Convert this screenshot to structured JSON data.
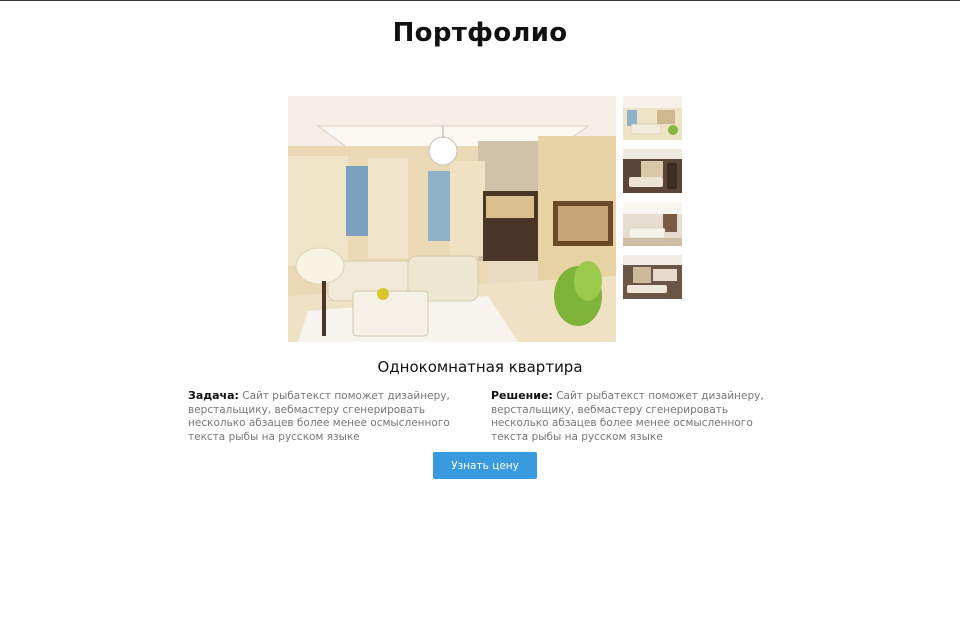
{
  "page": {
    "title": "Портфолио"
  },
  "gallery": {
    "main_alt": "living-room-photo",
    "thumbnails": [
      {
        "name": "thumb-living-room-1"
      },
      {
        "name": "thumb-dark-room"
      },
      {
        "name": "thumb-living-room-2"
      },
      {
        "name": "thumb-dark-room-2"
      }
    ]
  },
  "project": {
    "title": "Однокомнатная квартира",
    "task_label": "Задача:",
    "task_text": "Сайт рыбатекст поможет дизайнеру, верстальщику, вебмастеру сгенерировать несколько абзацев более менее осмысленного текста рыбы на русском языке",
    "solution_label": "Решение:",
    "solution_text": "Сайт рыбатекст поможет дизайнеру, верстальщику, вебмастеру сгенерировать несколько абзацев более менее осмысленного текста рыбы на русском языке"
  },
  "cta": {
    "label": "Узнать цену",
    "color": "#3a9ae0"
  }
}
